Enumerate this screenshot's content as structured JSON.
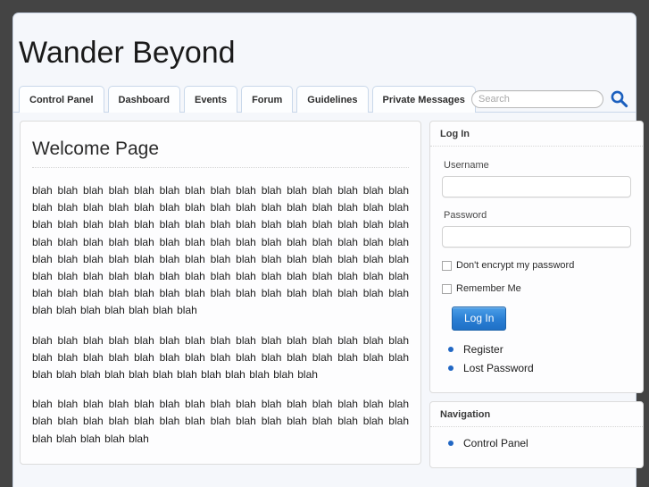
{
  "site": {
    "title": "Wander Beyond"
  },
  "nav": {
    "tabs": [
      {
        "label": "Control Panel",
        "name": "control-panel"
      },
      {
        "label": "Dashboard",
        "name": "dashboard"
      },
      {
        "label": "Events",
        "name": "events"
      },
      {
        "label": "Forum",
        "name": "forum"
      },
      {
        "label": "Guidelines",
        "name": "guidelines"
      },
      {
        "label": "Private Messages",
        "name": "private-messages"
      }
    ]
  },
  "search": {
    "placeholder": "Search",
    "value": "",
    "icon": "search-icon"
  },
  "main": {
    "heading": "Welcome Page",
    "paragraphs": [
      "blah blah blah blah blah blah blah blah blah blah blah blah blah blah blah blah blah blah blah blah blah blah blah blah blah blah blah blah blah blah blah blah blah blah blah blah blah blah blah blah blah blah blah blah blah blah blah blah blah blah blah blah blah blah blah blah blah blah blah blah blah blah blah blah blah blah blah blah blah blah blah blah blah blah blah blah blah blah blah blah blah blah blah blah blah blah blah blah blah blah blah blah blah blah blah blah blah blah blah blah blah blah blah blah blah blah blah blah blah blah blah blah",
      "blah blah blah blah blah blah blah blah blah blah blah blah blah blah blah blah blah blah blah blah blah blah blah blah blah blah blah blah blah blah blah blah blah blah blah blah blah blah blah blah blah blah",
      "blah blah blah blah blah blah blah blah blah blah blah blah blah blah blah blah blah blah blah blah blah blah blah blah blah blah blah blah blah blah blah blah blah blah blah"
    ]
  },
  "sidebar": {
    "login": {
      "title": "Log In",
      "username_label": "Username",
      "username_value": "",
      "password_label": "Password",
      "password_value": "",
      "no_encrypt_label": "Don't encrypt my password",
      "remember_label": "Remember Me",
      "submit_label": "Log In",
      "links": [
        {
          "label": "Register",
          "name": "register"
        },
        {
          "label": "Lost Password",
          "name": "lost-password"
        }
      ]
    },
    "navigation": {
      "title": "Navigation",
      "links": [
        {
          "label": "Control Panel",
          "name": "control-panel"
        }
      ]
    }
  },
  "colors": {
    "page_background": "#444444",
    "shell_background": "#f5f7fb",
    "panel_background": "#fdfdfe",
    "accent_blue": "#2167c4",
    "tab_border": "#c9d8ea",
    "button_blue": "#2a7fd4"
  }
}
